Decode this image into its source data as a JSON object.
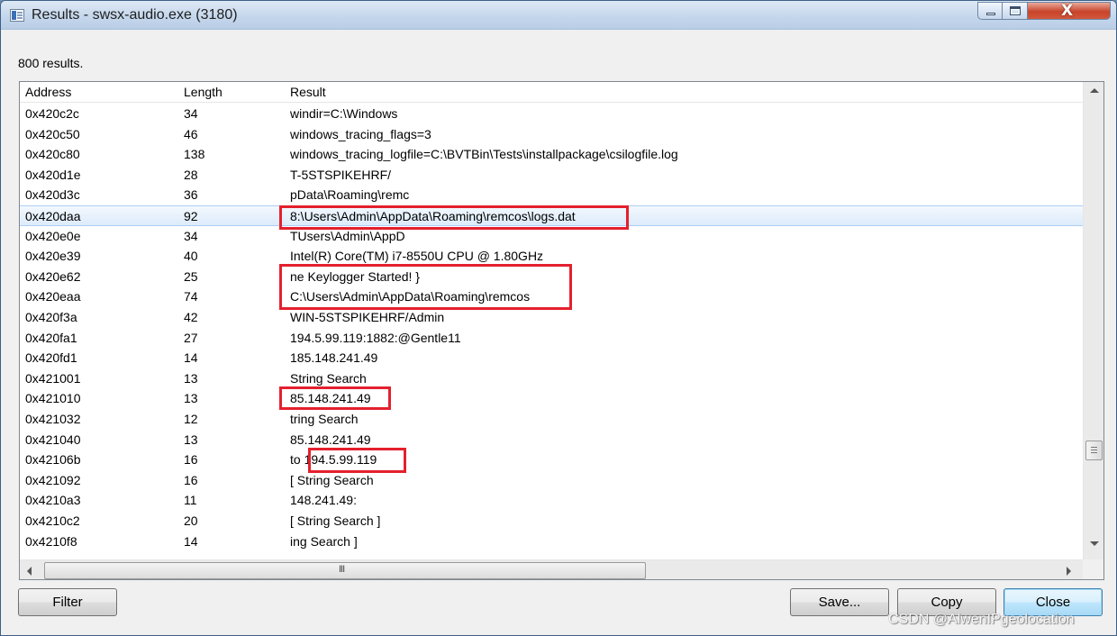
{
  "window": {
    "title": "Results - swsx-audio.exe (3180)",
    "close_glyph": "X"
  },
  "summary": "800 results.",
  "columns": [
    "Address",
    "Length",
    "Result"
  ],
  "rows": [
    {
      "address": "0x420c2c",
      "length": "34",
      "result": "windir=C:\\Windows"
    },
    {
      "address": "0x420c50",
      "length": "46",
      "result": "windows_tracing_flags=3"
    },
    {
      "address": "0x420c80",
      "length": "138",
      "result": "windows_tracing_logfile=C:\\BVTBin\\Tests\\installpackage\\csilogfile.log"
    },
    {
      "address": "0x420d1e",
      "length": "28",
      "result": "T-5STSPIKEHRF/"
    },
    {
      "address": "0x420d3c",
      "length": "36",
      "result": "pData\\Roaming\\remc"
    },
    {
      "address": "0x420daa",
      "length": "92",
      "result": "8:\\Users\\Admin\\AppData\\Roaming\\remcos\\logs.dat"
    },
    {
      "address": "0x420e0e",
      "length": "34",
      "result": "TUsers\\Admin\\AppD"
    },
    {
      "address": "0x420e39",
      "length": "40",
      "result": "Intel(R) Core(TM) i7-8550U CPU @ 1.80GHz"
    },
    {
      "address": "0x420e62",
      "length": "25",
      "result": "ne Keylogger Started! }"
    },
    {
      "address": "0x420eaa",
      "length": "74",
      "result": "C:\\Users\\Admin\\AppData\\Roaming\\remcos"
    },
    {
      "address": "0x420f3a",
      "length": "42",
      "result": "WIN-5STSPIKEHRF/Admin"
    },
    {
      "address": "0x420fa1",
      "length": "27",
      "result": "194.5.99.119:1882:@Gentle11"
    },
    {
      "address": "0x420fd1",
      "length": "14",
      "result": "185.148.241.49"
    },
    {
      "address": "0x421001",
      "length": "13",
      "result": "String Search"
    },
    {
      "address": "0x421010",
      "length": "13",
      "result": "85.148.241.49"
    },
    {
      "address": "0x421032",
      "length": "12",
      "result": "tring Search"
    },
    {
      "address": "0x421040",
      "length": "13",
      "result": "85.148.241.49"
    },
    {
      "address": "0x42106b",
      "length": "16",
      "result": " to 194.5.99.119"
    },
    {
      "address": "0x421092",
      "length": "16",
      "result": "[ String Search"
    },
    {
      "address": "0x4210a3",
      "length": "11",
      "result": "148.241.49:"
    },
    {
      "address": "0x4210c2",
      "length": "20",
      "result": "[ String Search ]"
    },
    {
      "address": "0x4210f8",
      "length": "14",
      "result": "ing Search ]"
    }
  ],
  "selected_row": 5,
  "hscroll_thumb_glyph": "III",
  "buttons": {
    "filter": "Filter",
    "save": "Save...",
    "copy": "Copy",
    "close": "Close"
  },
  "watermark": "CSDN @AlwenIPgeolocation",
  "colors": {
    "highlight_box": "#e4202e",
    "selection": "#dcebfc"
  }
}
